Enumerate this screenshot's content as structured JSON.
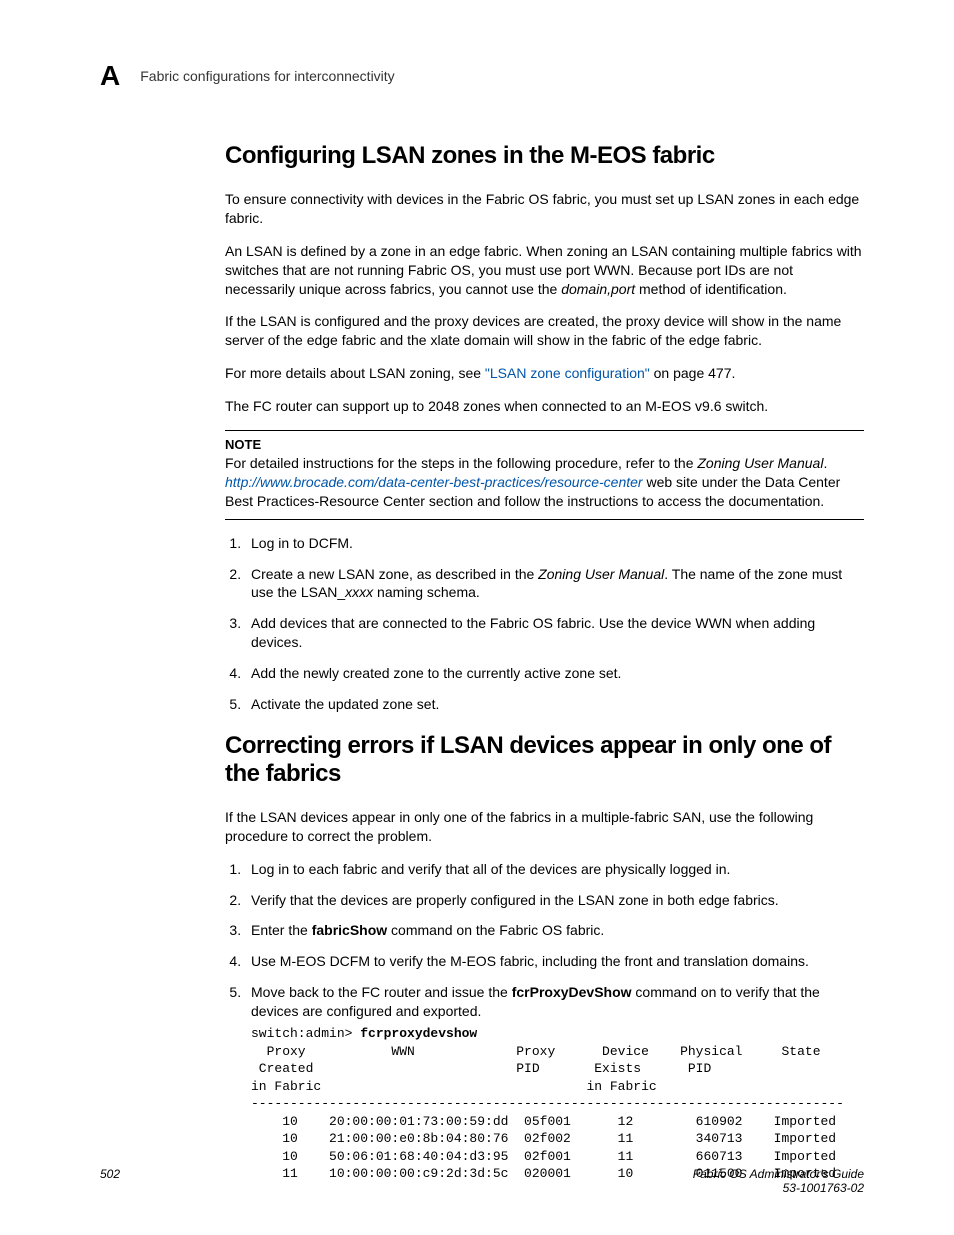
{
  "header": {
    "letter": "A",
    "breadcrumb": "Fabric configurations for interconnectivity"
  },
  "section1": {
    "title": "Configuring LSAN zones in the M-EOS fabric",
    "p1": "To ensure connectivity with devices in the Fabric OS fabric, you must set up LSAN zones in each edge fabric.",
    "p2a": "An LSAN is defined by a zone in an edge fabric. When zoning an LSAN containing multiple fabrics with switches that are not running Fabric OS, you must use port WWN. Because port IDs are not necessarily unique across fabrics, you cannot use the ",
    "p2b": "domain,port",
    "p2c": " method of identification.",
    "p3": "If the LSAN is configured and the proxy devices are created, the proxy device will show in the name server of the edge fabric and the xlate domain will show in the fabric of the edge fabric.",
    "p4a": "For more details about LSAN zoning, see ",
    "p4link": "\"LSAN zone configuration\"",
    "p4b": " on page 477.",
    "p5": "The FC router can support up to 2048 zones when connected to an M-EOS v9.6 switch.",
    "note": {
      "title": "NOTE",
      "line1a": "For detailed instructions for the steps in the following procedure, refer to the ",
      "line1b": "Zoning User Manual",
      "line1c": ". ",
      "link": "http://www.brocade.com/data-center-best-practices/resource-center",
      "line2": " web site under the Data Center Best Practices-Resource Center section and follow the instructions to access the documentation."
    },
    "steps": {
      "s1": "Log in to DCFM.",
      "s2a": "Create a new LSAN zone, as described in the ",
      "s2b": "Zoning User Manual",
      "s2c": ". The name of the zone must use the LSAN_",
      "s2d": "xxxx",
      "s2e": " naming schema.",
      "s3": "Add devices that are connected to the Fabric OS fabric. Use the device WWN when adding devices.",
      "s4": "Add the newly created zone to the currently active zone set.",
      "s5": "Activate the updated zone set."
    }
  },
  "section2": {
    "title": "Correcting errors if LSAN devices appear in only one of the fabrics",
    "p1": "If the LSAN devices appear in only one of the fabrics in a multiple-fabric SAN, use the following procedure to correct the problem.",
    "steps": {
      "s1": "Log in to each fabric and verify that all of the devices are physically logged in.",
      "s2": "Verify that the devices are properly configured in the LSAN zone in both edge fabrics.",
      "s3a": "Enter the ",
      "s3b": "fabricShow",
      "s3c": " command on the Fabric OS fabric.",
      "s4": "Use M-EOS DCFM to verify the M-EOS fabric, including the front and translation domains.",
      "s5a": "Move back to the FC router and issue the ",
      "s5b": "fcrProxyDevShow",
      "s5c": " command on to verify that the devices are configured and exported."
    },
    "code": {
      "prompt": "switch:admin> ",
      "cmd": "fcrproxydevshow",
      "body": "  Proxy           WWN             Proxy      Device    Physical     State\n Created                          PID       Exists      PID\nin Fabric                                  in Fabric\n----------------------------------------------------------------------------\n    10    20:00:00:01:73:00:59:dd  05f001      12        610902    Imported\n    10    21:00:00:e0:8b:04:80:76  02f002      11        340713    Imported\n    10    50:06:01:68:40:04:d3:95  02f001      11        660713    Imported\n    11    10:00:00:00:c9:2d:3d:5c  020001      10        011500    Imported"
    }
  },
  "footer": {
    "page": "502",
    "title": "Fabric OS Administrator's Guide",
    "docnum": "53-1001763-02"
  }
}
